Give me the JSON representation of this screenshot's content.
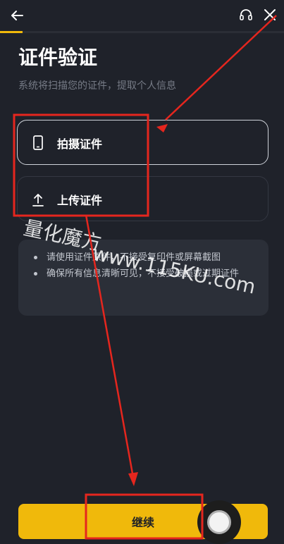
{
  "header": {
    "back_icon": "back-arrow-icon",
    "support_icon": "headset-icon",
    "close_icon": "close-icon",
    "progress_percent": 8,
    "accent": "#f0b90b"
  },
  "page": {
    "title": "证件验证",
    "subtitle": "系统将扫描您的证件，提取个人信息"
  },
  "options": [
    {
      "label": "拍摄证件",
      "icon": "phone-icon"
    },
    {
      "label": "上传证件",
      "icon": "upload-icon"
    }
  ],
  "tips": [
    "请使用证件原件，不接受复印件或屏幕截图",
    "确保所有信息清晰可见，不接受破损或过期证件"
  ],
  "continue_label": "继续",
  "watermark": {
    "text1": "量化魔方",
    "text2": "www.115KU.com"
  }
}
